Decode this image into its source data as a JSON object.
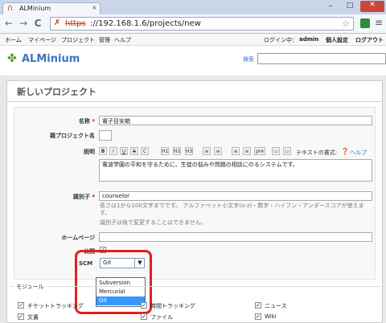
{
  "browser": {
    "tab_title": "ALMinium",
    "tab_icon": "redmine-logo-icon",
    "tab_close": "×",
    "window_buttons": {
      "minimize": "–",
      "maximize": "□",
      "close": "✕"
    },
    "nav": {
      "back": "←",
      "forward": "→",
      "reload": "C"
    },
    "address": {
      "scheme": "https",
      "rest": "://192.168.1.6/projects/new",
      "security_icon": "✗",
      "star": "☆"
    },
    "menu_glyph": "≡"
  },
  "top_menu": {
    "left": [
      "ホーム",
      "マイページ",
      "プロジェクト",
      "管理",
      "ヘルプ"
    ],
    "logged_in_label": "ログイン中：",
    "username": "admin",
    "my_account": "個人設定",
    "logout": "ログアウト"
  },
  "header": {
    "logo_text": "ALMinium",
    "logo_icon": "✤",
    "search_label": "検索",
    "search_value": ""
  },
  "page": {
    "title": "新しいプロジェクト",
    "fields": {
      "name_label": "名称",
      "name_value": "電子目安箱",
      "parent_label": "親プロジェクト名",
      "parent_value": "",
      "description_label": "説明",
      "text_format_label": "テキストの書式:",
      "text_format_help": "ヘルプ",
      "description_value": "電波学園の平和を守るために、生徒の悩みや問題の相談にのるシステムです。",
      "identifier_label": "識別子",
      "identifier_value": "counselor",
      "identifier_hint1": "長さは1から100文字までです。 アルファベット小文字(a-z)・数字・ハイフン・アンダースコアが使えます。",
      "identifier_hint2": "識別子は後で変更することはできません。",
      "homepage_label": "ホームページ",
      "homepage_value": "",
      "public_label": "公開",
      "public_checked": true,
      "scm_label": "SCM",
      "scm_selected": "Git",
      "scm_options": [
        "Subversion",
        "Mercurial",
        "Git"
      ]
    },
    "toolbar_buttons": [
      "B",
      "I",
      "U",
      "S",
      "C",
      "H1",
      "H2",
      "H3",
      "≡",
      "≡",
      "≡",
      "≡",
      "pre",
      "▭",
      "▭"
    ],
    "modules": {
      "legend": "モジュール",
      "items": [
        {
          "label": "チケットトラッキング",
          "checked": true
        },
        {
          "label": "時間トラッキング",
          "checked": true
        },
        {
          "label": "ニュース",
          "checked": true
        },
        {
          "label": "文書",
          "checked": true
        },
        {
          "label": "ファイル",
          "checked": true
        },
        {
          "label": "Wiki",
          "checked": true
        }
      ]
    }
  },
  "colors": {
    "highlight": "#e02020",
    "link": "#3a75c4",
    "required": "#cc0000",
    "selected_option": "#3399ff"
  }
}
